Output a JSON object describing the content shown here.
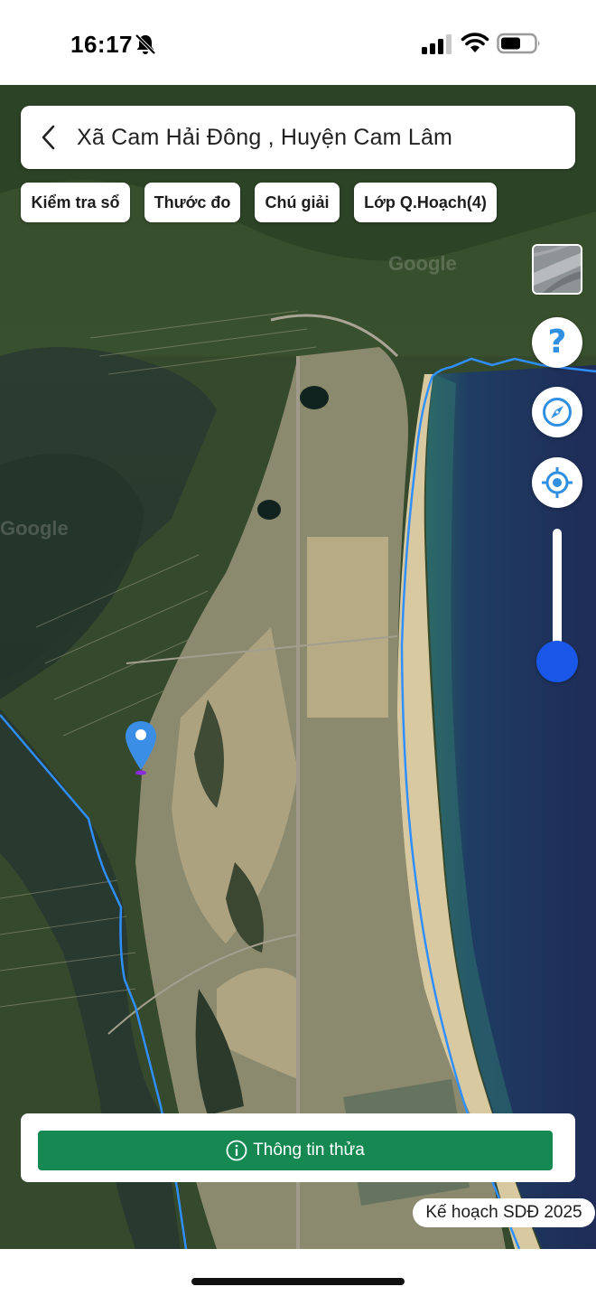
{
  "status_bar": {
    "time": "16:17"
  },
  "header": {
    "title": "Xã Cam Hải Đông , Huyện Cam Lâm"
  },
  "chips": [
    {
      "label": "Kiểm tra sổ"
    },
    {
      "label": "Thước đo"
    },
    {
      "label": "Chú giải"
    },
    {
      "label": "Lớp Q.Hoạch(4)"
    }
  ],
  "controls": {
    "help_glyph": "?",
    "zoom_level": 0.08
  },
  "map": {
    "watermarks": [
      "Google",
      "Google"
    ],
    "boundary_color": "#2f8fff",
    "marker_color": "#3b8ee6"
  },
  "bottom": {
    "info_button_label": "Thông tin thửa",
    "plan_badge": "Kế hoạch SDĐ 2025",
    "accent_color": "#168952"
  }
}
